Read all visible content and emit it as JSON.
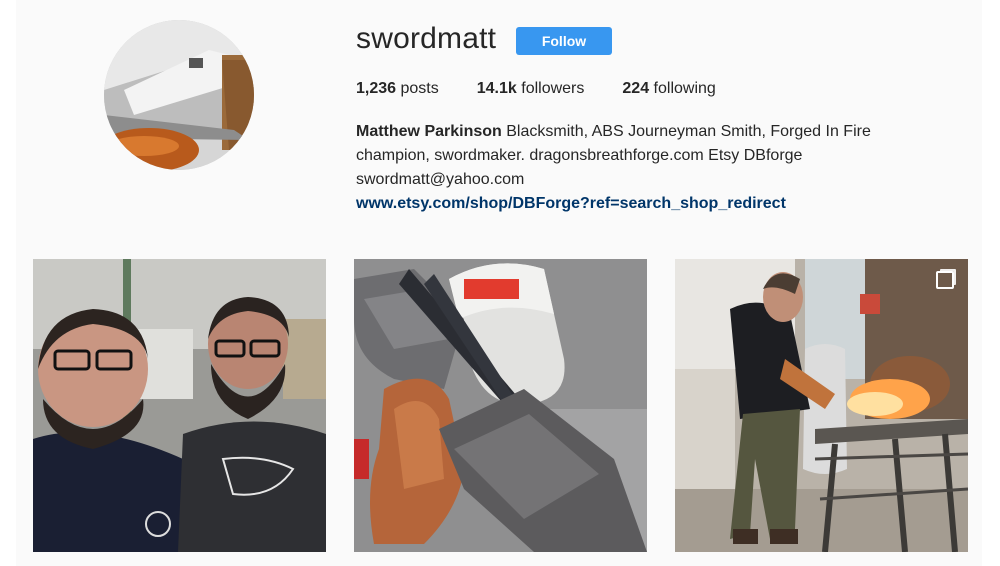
{
  "profile": {
    "username": "swordmatt",
    "follow_label": "Follow",
    "avatar_icon": "avatar-photo",
    "stats": {
      "posts_count": "1,236",
      "posts_label": "posts",
      "followers_count": "14.1k",
      "followers_label": "followers",
      "following_count": "224",
      "following_label": "following"
    },
    "bio": {
      "name": "Matthew Parkinson",
      "line1": " Blacksmith, ABS Journeyman Smith, Forged In Fire",
      "line2": "champion, swordmaker. dragonsbreathforge.com Etsy DBforge",
      "line3": "swordmatt@yahoo.com",
      "link": "www.etsy.com/shop/DBForge?ref=search_shop_redirect"
    }
  },
  "posts": [
    {
      "subject": "two-men-selfie",
      "multi": false
    },
    {
      "subject": "anvil-glove-propane",
      "multi": false
    },
    {
      "subject": "forging-at-furnace",
      "multi": true
    }
  ],
  "colors": {
    "accent": "#3897f0",
    "link": "#003569",
    "background": "#fafafa"
  }
}
